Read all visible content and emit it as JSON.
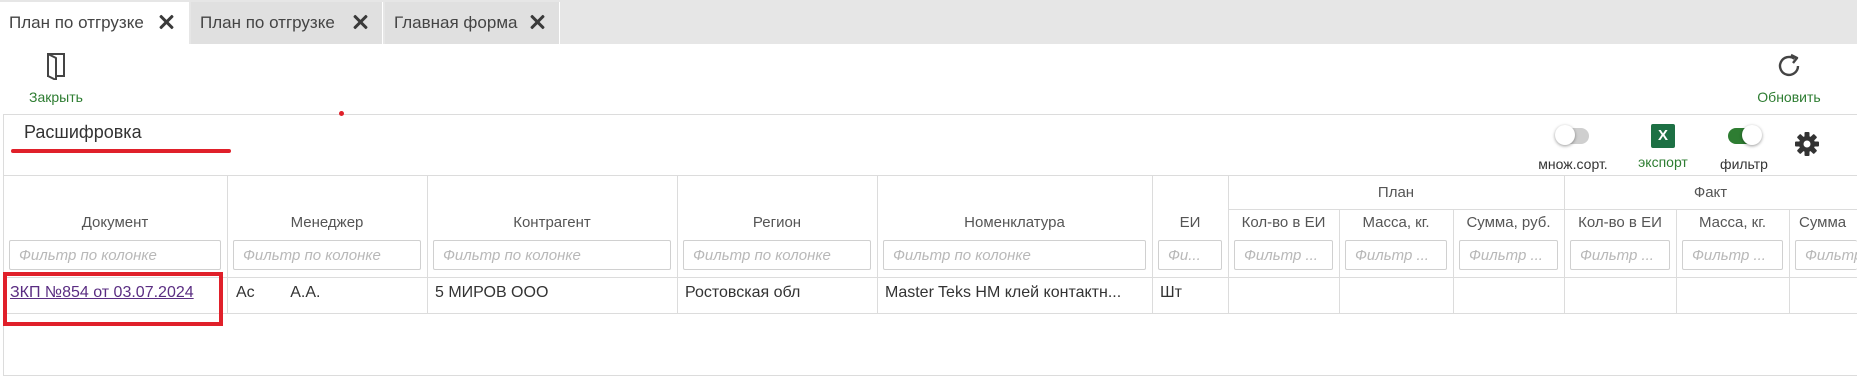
{
  "tabs": [
    {
      "label": "План по отгрузке"
    },
    {
      "label": "План по отгрузке"
    },
    {
      "label": "Главная форма"
    }
  ],
  "toolbar": {
    "close_label": "Закрыть",
    "refresh_label": "Обновить"
  },
  "panel": {
    "title": "Расшифровка",
    "controls": {
      "multisort_label": "множ.сорт.",
      "multisort_on": false,
      "export_label": "экспорт",
      "export_icon_text": "X",
      "filter_label": "фильтр",
      "filter_on": true
    }
  },
  "table": {
    "group_headers": {
      "plan": "План",
      "fact": "Факт"
    },
    "columns": {
      "document": "Документ",
      "manager": "Менеджер",
      "counterparty": "Контрагент",
      "region": "Регион",
      "nomenclature": "Номенклатура",
      "unit": "ЕИ",
      "plan_qty": "Кол-во в ЕИ",
      "plan_mass": "Масса, кг.",
      "plan_sum": "Сумма, руб.",
      "fact_qty": "Кол-во в ЕИ",
      "fact_mass": "Масса, кг.",
      "fact_sum": "Сумма"
    },
    "filter_placeholder": "Фильтр по колонке",
    "filter_placeholder_short": "Фильтр ...",
    "filter_placeholder_tiny": "Фи...",
    "rows": [
      {
        "document": "ЗКП №854 от 03.07.2024",
        "manager": "Ас        А.А.",
        "counterparty": "5 МИРОВ ООО",
        "region": "Ростовская обл",
        "nomenclature": "Master Teks HM клей контактн...",
        "unit": "Шт"
      }
    ]
  },
  "colors": {
    "accent": "#2e7d32",
    "highlight": "#e0202a",
    "link": "#5a2d82"
  }
}
